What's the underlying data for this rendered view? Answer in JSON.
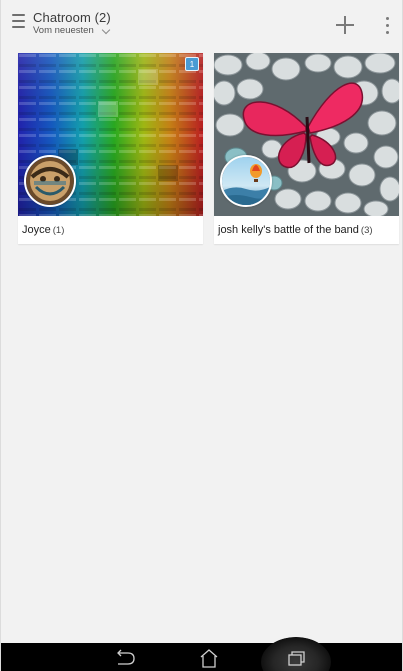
{
  "header": {
    "title": "Chatroom (2)",
    "sort_label": "Vom neuesten",
    "menu_icon": "hamburger-menu-icon",
    "add_icon": "plus-icon",
    "more_icon": "more-vertical-icon"
  },
  "rooms": [
    {
      "name": "Joyce",
      "count": "(1)",
      "unread_badge": "1",
      "thumbnail": "rainbow-cubes-image",
      "avatar": "smile-avatar"
    },
    {
      "name": "josh kelly's battle of the band",
      "count": "(3)",
      "thumbnail": "pink-butterfly-pebbles-image",
      "avatar": "hot-air-balloon-avatar"
    }
  ],
  "navbar": {
    "back_icon": "back-icon",
    "home_icon": "home-icon",
    "recent_icon": "recent-apps-icon"
  },
  "colors": {
    "background": "#f2f2f2",
    "badge": "#4a9bd3",
    "navbar": "#000000"
  }
}
